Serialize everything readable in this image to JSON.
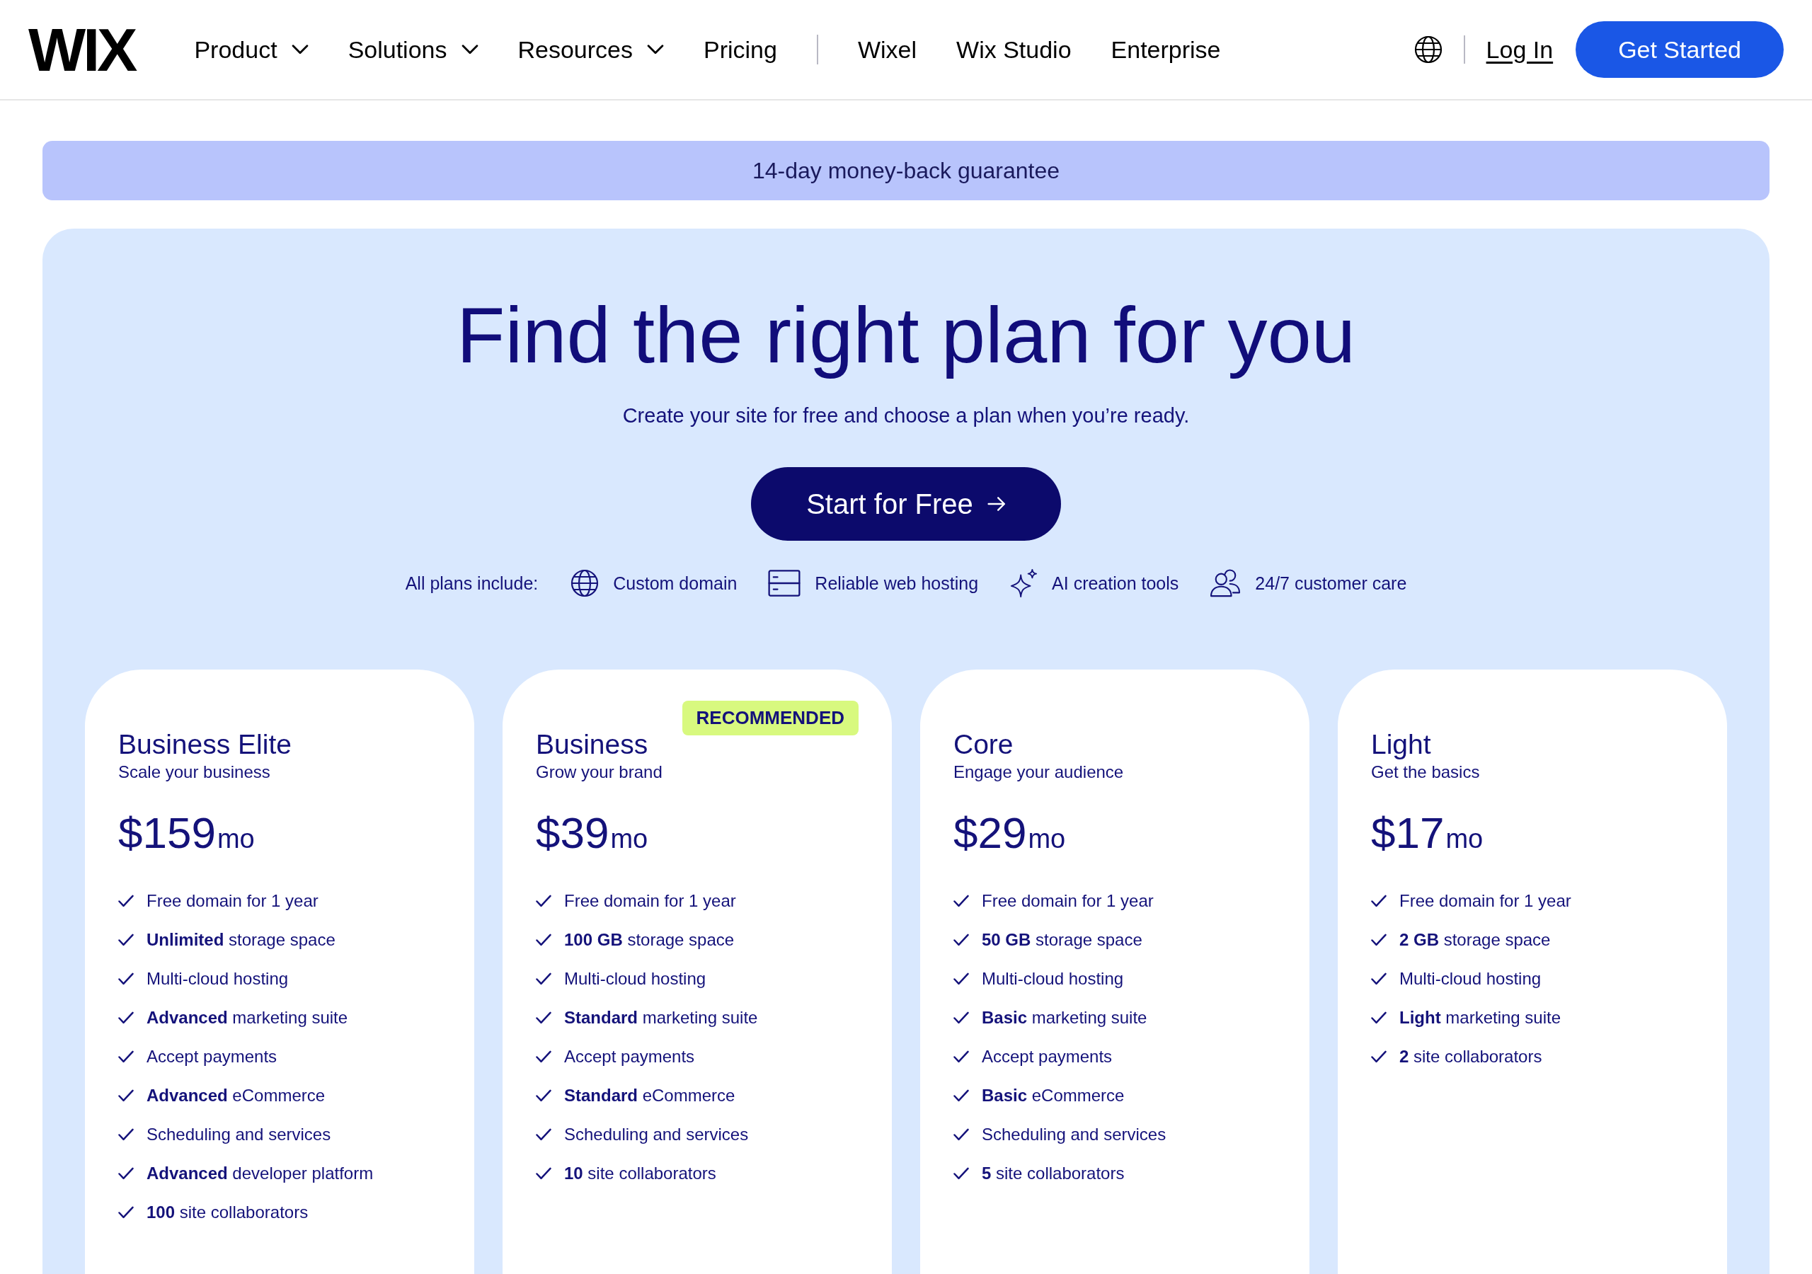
{
  "header": {
    "logo": "WIX",
    "nav": [
      {
        "label": "Product",
        "has_menu": true
      },
      {
        "label": "Solutions",
        "has_menu": true
      },
      {
        "label": "Resources",
        "has_menu": true
      },
      {
        "label": "Pricing",
        "has_menu": false
      }
    ],
    "nav_secondary": [
      "Wixel",
      "Wix Studio",
      "Enterprise"
    ],
    "login": "Log In",
    "cta": "Get Started"
  },
  "banner": {
    "text": "14-day money-back guarantee"
  },
  "hero": {
    "title": "Find the right plan for you",
    "subtitle": "Create your site for free and choose a plan when you’re ready.",
    "button": "Start for Free"
  },
  "includes": {
    "label": "All plans include:",
    "items": [
      "Custom domain",
      "Reliable web hosting",
      "AI creation tools",
      "24/7 customer care"
    ]
  },
  "plans": [
    {
      "name": "Business Elite",
      "tagline": "Scale your business",
      "price": "$159",
      "period": "mo",
      "features": [
        "Free domain for 1 year",
        "**Unlimited** storage space",
        "Multi-cloud hosting",
        "**Advanced** marketing suite",
        "Accept payments",
        "**Advanced** eCommerce",
        "Scheduling and services",
        "**Advanced** developer platform",
        "**100** site collaborators"
      ]
    },
    {
      "name": "Business",
      "tagline": "Grow your brand",
      "badge": "RECOMMENDED",
      "price": "$39",
      "period": "mo",
      "features": [
        "Free domain for 1 year",
        "**100 GB** storage space",
        "Multi-cloud hosting",
        "**Standard** marketing suite",
        "Accept payments",
        "**Standard** eCommerce",
        "Scheduling and services",
        "**10** site collaborators"
      ]
    },
    {
      "name": "Core",
      "tagline": "Engage your audience",
      "price": "$29",
      "period": "mo",
      "features": [
        "Free domain for 1 year",
        "**50 GB** storage space",
        "Multi-cloud hosting",
        "**Basic** marketing suite",
        "Accept payments",
        "**Basic** eCommerce",
        "Scheduling and services",
        "**5** site collaborators"
      ]
    },
    {
      "name": "Light",
      "tagline": "Get the basics",
      "price": "$17",
      "period": "mo",
      "features": [
        "Free domain for 1 year",
        "**2 GB** storage space",
        "Multi-cloud hosting",
        "**Light** marketing suite",
        "**2** site collaborators"
      ]
    }
  ]
}
